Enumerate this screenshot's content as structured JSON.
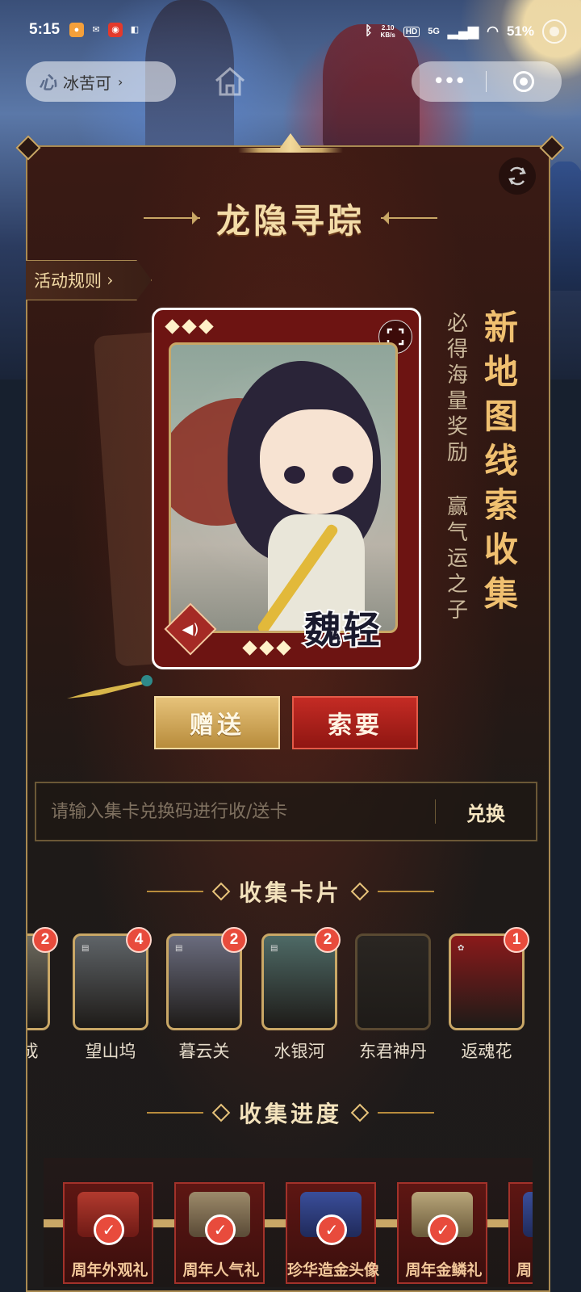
{
  "status_bar": {
    "time": "5:15",
    "net_speed_value": "2.10",
    "net_speed_unit": "KB/s",
    "hd": "HD",
    "network": "5G",
    "battery": "51%"
  },
  "miniprogram": {
    "logo": "心",
    "name": "冰苦可"
  },
  "capsule": {
    "more": "•••"
  },
  "event": {
    "title": "龙隐寻踪",
    "rules": "活动规则"
  },
  "card": {
    "character_name": "魏轻"
  },
  "side_text": {
    "headline": "新地图线索收集",
    "line1": "必得海量奖励",
    "line2": "赢气运之子"
  },
  "actions": {
    "gift": "赠送",
    "ask": "索要"
  },
  "redeem": {
    "placeholder": "请输入集卡兑换码进行收/送卡",
    "button": "兑换"
  },
  "collection": {
    "title": "收集卡片",
    "cards": [
      {
        "name": "成",
        "count": "2",
        "color": "#6d6a5e"
      },
      {
        "name": "望山坞",
        "count": "4",
        "color": "#5f6468"
      },
      {
        "name": "暮云关",
        "count": "2",
        "color": "#6a6c7e"
      },
      {
        "name": "水银河",
        "count": "2",
        "color": "#4e6a66"
      },
      {
        "name": "东君神丹",
        "count": "",
        "color": "#2a2622"
      },
      {
        "name": "返魂花",
        "count": "1",
        "color": "#8a1a1a"
      }
    ]
  },
  "progress": {
    "title": "收集进度",
    "rewards": [
      {
        "label": "周年外观礼",
        "claimed": true
      },
      {
        "label": "周年人气礼",
        "claimed": true
      },
      {
        "label": "珍华造金头像",
        "claimed": true
      },
      {
        "label": "周年金鳞礼",
        "claimed": true
      },
      {
        "label": "周",
        "claimed": false
      }
    ]
  },
  "colors": {
    "gold": "#c9a766",
    "red_accent": "#e84b3c",
    "panel_bg": "#2b1712"
  }
}
